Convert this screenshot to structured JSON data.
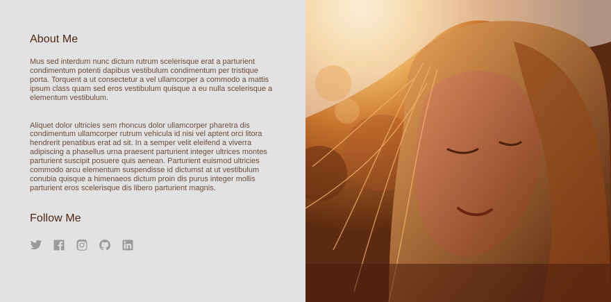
{
  "about": {
    "title": "About Me",
    "paragraph1": "Mus sed interdum nunc dictum rutrum scelerisque erat a parturient condimentum potenti dapibus vestibulum condimentum per tristique porta. Torquent a ut consectetur a vel ullamcorper a commodo a mattis ipsum class quam sed eros vestibulum quisque a eu nulla scelerisque a elementum vestibulum.",
    "paragraph2": "Aliquet dolor ultricies sem rhoncus dolor ullamcorper pharetra dis condimentum ullamcorper rutrum vehicula id nisi vel aptent orci litora hendrerit penatibus erat ad sit. In a semper velit eleifend a viverra adipiscing a phasellus urna praesent parturient integer ultrices montes parturient suscipit posuere quis aenean. Parturient euismod ultricies commodo arcu elementum suspendisse id dictumst at ut vestibulum conubia quisque a himenaeos dictum proin dis purus integer mollis parturient eros scelerisque dis libero parturient magnis."
  },
  "follow": {
    "title": "Follow Me",
    "icons": [
      "twitter-icon",
      "facebook-icon",
      "instagram-icon",
      "github-icon",
      "linkedin-icon"
    ]
  },
  "colors": {
    "background": "#e3e2e2",
    "heading": "#4b2512",
    "body_text": "#6a4c3c",
    "icon": "#9a9a9a"
  }
}
